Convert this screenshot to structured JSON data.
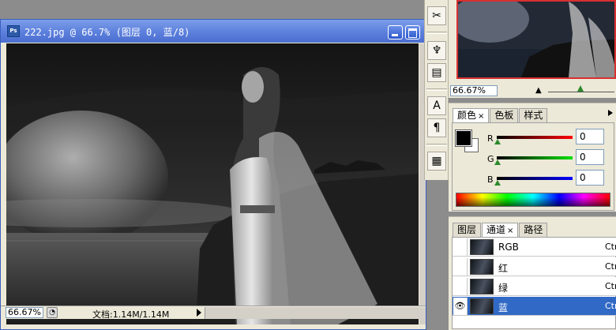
{
  "document": {
    "title": "222.jpg @ 66.7% (图层 0, 蓝/8)",
    "app_icon": "Ps",
    "zoom": "66.67%",
    "doc_info": "文档:1.14M/1.14M"
  },
  "toolstrip": {
    "icons": [
      "brush-preset-icon",
      "tool-preset-icon",
      "clone-source-icon",
      "character-icon",
      "paragraph-icon",
      "notes-icon"
    ]
  },
  "navigator": {
    "zoom": "66.67%"
  },
  "color_panel": {
    "tabs": [
      {
        "label": "颜色",
        "close": "×"
      },
      {
        "label": "色板"
      },
      {
        "label": "样式"
      }
    ],
    "channels": [
      {
        "label": "R",
        "value": "0"
      },
      {
        "label": "G",
        "value": "0"
      },
      {
        "label": "B",
        "value": "0"
      }
    ],
    "foreground": "#000000",
    "background": "#ffffff"
  },
  "channels_panel": {
    "tabs": [
      {
        "label": "图层"
      },
      {
        "label": "通道",
        "close": "×"
      },
      {
        "label": "路径"
      }
    ],
    "rows": [
      {
        "name": "RGB",
        "shortcut": "Ctrl"
      },
      {
        "name": "红",
        "shortcut": "Ctrl"
      },
      {
        "name": "绿",
        "shortcut": "Ctrl"
      },
      {
        "name": "蓝",
        "shortcut": "Ctrl",
        "eye": "👁"
      }
    ]
  },
  "colors": {
    "title_bar": "#5b7fdc",
    "selection": "#3169c6",
    "thumb_border": "#d83030"
  }
}
